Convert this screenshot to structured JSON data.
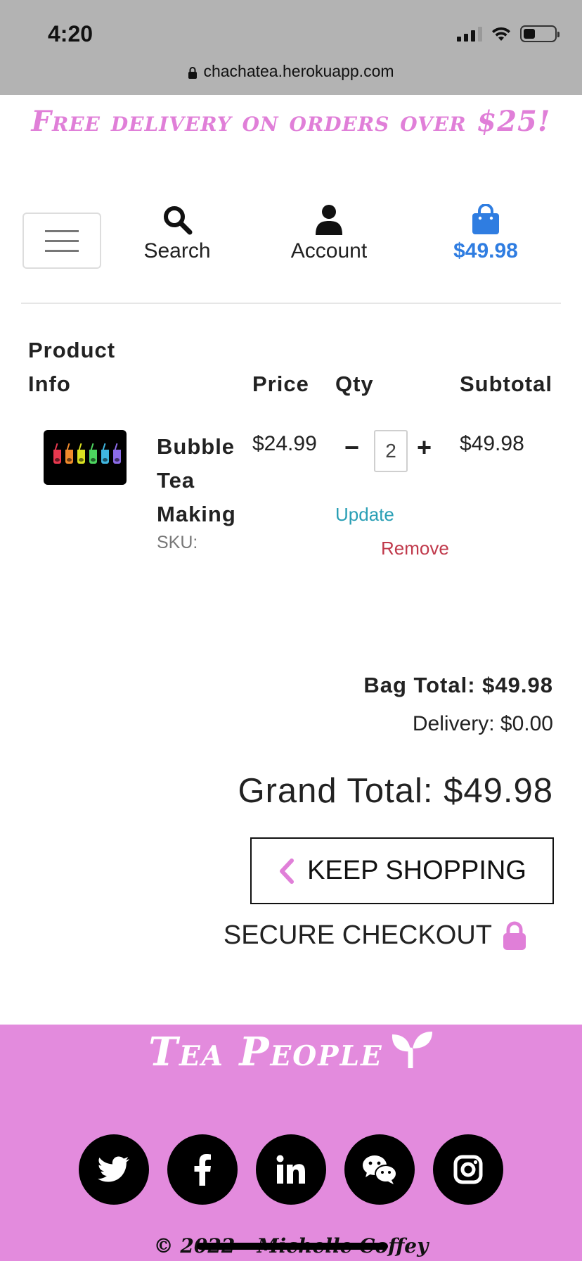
{
  "status_bar": {
    "time": "4:20"
  },
  "browser": {
    "url": "chachatea.herokuapp.com"
  },
  "banner": {
    "text": "Free delivery on orders over $25!"
  },
  "header": {
    "search_label": "Search",
    "account_label": "Account",
    "bag_total": "$49.98"
  },
  "table": {
    "headers": {
      "product": "Product Info",
      "price": "Price",
      "qty": "Qty",
      "subtotal": "Subtotal"
    },
    "rows": [
      {
        "name": "Bubble Tea Making",
        "sku": "SKU:",
        "price": "$24.99",
        "qty": "2",
        "subtotal": "$49.98",
        "update_label": "Update",
        "remove_label": "Remove"
      }
    ]
  },
  "totals": {
    "bag_total": "Bag Total: $49.98",
    "delivery": "Delivery: $0.00",
    "grand_total": "Grand Total: $49.98"
  },
  "actions": {
    "keep_shopping": "KEEP SHOPPING",
    "secure_checkout": "SECURE CHECKOUT"
  },
  "footer": {
    "brand": "Tea People",
    "social_icons": [
      "twitter-icon",
      "facebook-icon",
      "linkedin-icon",
      "wechat-icon",
      "instagram-icon"
    ],
    "copyright": "© 2022 - Michelle Coffey"
  },
  "colors": {
    "accent_pink": "#e07fd8",
    "footer_pink": "#e38bdd",
    "bag_blue": "#2f7de1",
    "update_teal": "#2a9fb5",
    "remove_red": "#c0394b"
  }
}
